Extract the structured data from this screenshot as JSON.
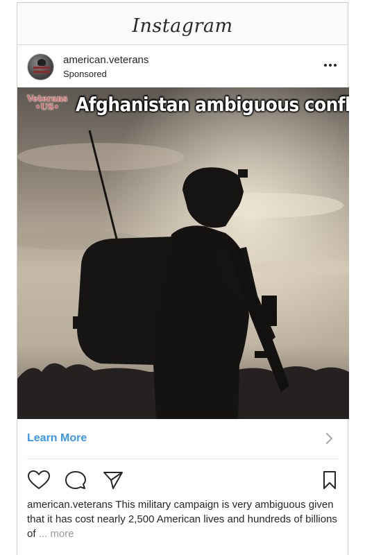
{
  "app": {
    "title": "Instagram"
  },
  "post": {
    "username": "american.veterans",
    "sponsored_label": "Sponsored",
    "more_icon": "more-horizontal-icon",
    "image": {
      "brand_line1": "Veterans",
      "brand_line2": "•US•",
      "headline": "Afghanistan ambiguous conflict"
    },
    "cta_label": "Learn More",
    "cta_icon": "chevron-right-icon",
    "actions": {
      "like_icon": "heart-icon",
      "comment_icon": "comment-icon",
      "share_icon": "send-icon",
      "save_icon": "bookmark-icon"
    },
    "caption": {
      "username": "american.veterans",
      "text": " This military campaign is very ambiguous given that it has cost nearly 2,500 American lives and hundreds of billions of ",
      "ellipsis": "...",
      "more_label": " more"
    }
  },
  "colors": {
    "link_blue": "#3897f0",
    "text": "#262626",
    "muted": "#999999",
    "brand_red": "#d36a6a"
  }
}
